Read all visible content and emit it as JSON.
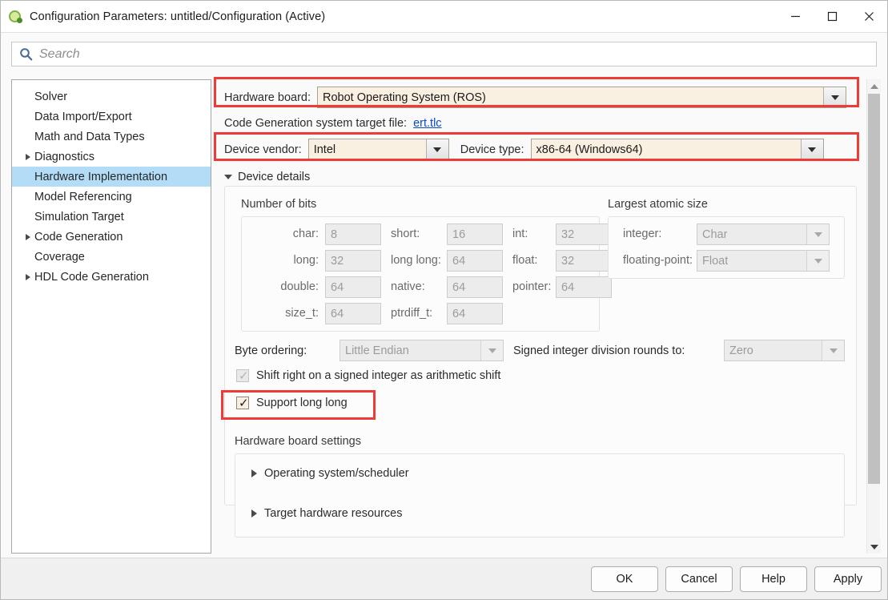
{
  "window": {
    "title": "Configuration Parameters: untitled/Configuration (Active)",
    "icon": "simulink-icon",
    "minimize": "minimize-icon",
    "maximize": "maximize-icon",
    "close": "close-icon"
  },
  "search": {
    "placeholder": "Search",
    "value": "",
    "icon": "search-icon"
  },
  "sidebar": {
    "items": [
      {
        "label": "Solver",
        "expandable": false,
        "selected": false
      },
      {
        "label": "Data Import/Export",
        "expandable": false,
        "selected": false
      },
      {
        "label": "Math and Data Types",
        "expandable": false,
        "selected": false
      },
      {
        "label": "Diagnostics",
        "expandable": true,
        "selected": false
      },
      {
        "label": "Hardware Implementation",
        "expandable": false,
        "selected": true
      },
      {
        "label": "Model Referencing",
        "expandable": false,
        "selected": false
      },
      {
        "label": "Simulation Target",
        "expandable": false,
        "selected": false
      },
      {
        "label": "Code Generation",
        "expandable": true,
        "selected": false
      },
      {
        "label": "Coverage",
        "expandable": false,
        "selected": false
      },
      {
        "label": "HDL Code Generation",
        "expandable": true,
        "selected": false
      }
    ]
  },
  "main": {
    "hardware_board": {
      "label": "Hardware board:",
      "value": "Robot Operating System (ROS)"
    },
    "target_file": {
      "label": "Code Generation system target file:",
      "link": "ert.tlc"
    },
    "device_vendor": {
      "label": "Device vendor:",
      "value": "Intel"
    },
    "device_type": {
      "label": "Device type:",
      "value": "x86-64 (Windows64)"
    },
    "device_details": {
      "section_label": "Device details",
      "expanded": true,
      "number_of_bits": {
        "title": "Number of bits",
        "fields": [
          {
            "label": "char:",
            "value": "8"
          },
          {
            "label": "short:",
            "value": "16"
          },
          {
            "label": "int:",
            "value": "32"
          },
          {
            "label": "long:",
            "value": "32"
          },
          {
            "label": "long long:",
            "value": "64"
          },
          {
            "label": "float:",
            "value": "32"
          },
          {
            "label": "double:",
            "value": "64"
          },
          {
            "label": "native:",
            "value": "64"
          },
          {
            "label": "pointer:",
            "value": "64"
          },
          {
            "label": "size_t:",
            "value": "64"
          },
          {
            "label": "ptrdiff_t:",
            "value": "64"
          }
        ]
      },
      "largest_atomic_size": {
        "title": "Largest atomic size",
        "integer": {
          "label": "integer:",
          "value": "Char"
        },
        "floating_point": {
          "label": "floating-point:",
          "value": "Float"
        }
      },
      "byte_ordering": {
        "label": "Byte ordering:",
        "value": "Little Endian"
      },
      "signed_division": {
        "label": "Signed integer division rounds to:",
        "value": "Zero"
      },
      "shift_right": {
        "label": "Shift right on a signed integer as arithmetic shift",
        "checked": true,
        "enabled": false
      },
      "support_long_long": {
        "label": "Support long long",
        "checked": true,
        "enabled": true
      }
    },
    "hardware_board_settings": {
      "title": "Hardware board settings",
      "groups": [
        {
          "label": "Operating system/scheduler",
          "expanded": false
        },
        {
          "label": "Target hardware resources",
          "expanded": false
        }
      ]
    }
  },
  "footer": {
    "buttons": [
      {
        "label": "OK"
      },
      {
        "label": "Cancel"
      },
      {
        "label": "Help"
      },
      {
        "label": "Apply"
      }
    ]
  },
  "colors": {
    "annotation": "#f03a36",
    "selection": "#b3ddf7",
    "modified_field": "#faf0e1",
    "link": "#0b48c9"
  }
}
